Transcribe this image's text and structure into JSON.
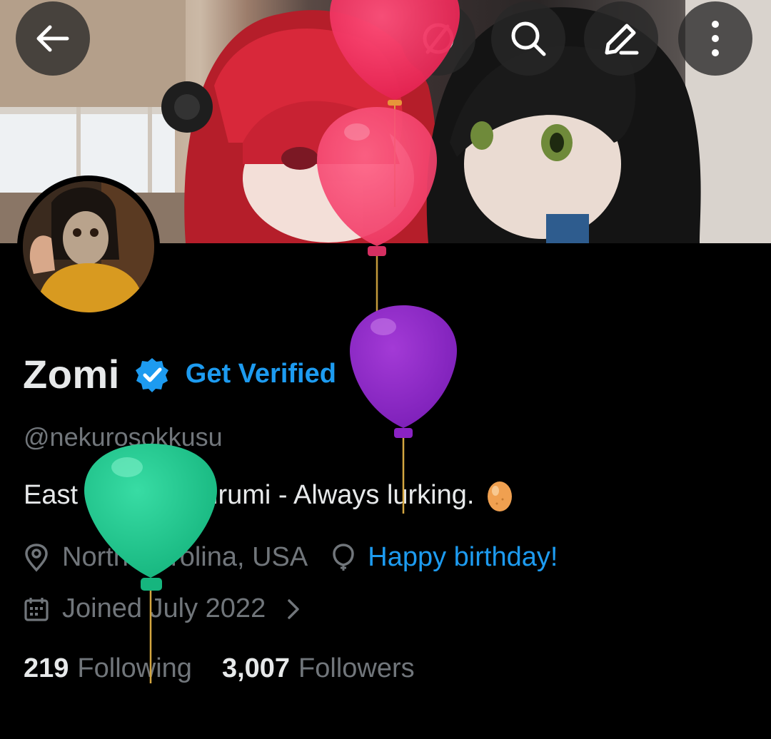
{
  "profile": {
    "name": "Zomi",
    "get_verified": "Get Verified",
    "handle": "@nekurosokkusu",
    "bio": "East Coast Kigurumi - Always lurking.",
    "location": "North Carolina, USA",
    "birthday": "Happy birthday!",
    "joined": "Joined July 2022",
    "following_count": "219",
    "following_label": "Following",
    "followers_count": "3,007",
    "followers_label": "Followers"
  },
  "icons": {
    "back": "back-arrow-icon",
    "no_grok": "slash-circle-icon",
    "search": "search-icon",
    "edit": "edit-pencil-icon",
    "more": "more-vertical-icon",
    "verified": "verified-badge-icon",
    "location": "location-pin-icon",
    "birthday": "balloon-icon",
    "calendar": "calendar-icon",
    "chevron": "chevron-right-icon"
  },
  "colors": {
    "background": "#000000",
    "accent": "#1d9bf0",
    "secondary_text": "#71767b",
    "primary_text": "#e7e9ea"
  }
}
